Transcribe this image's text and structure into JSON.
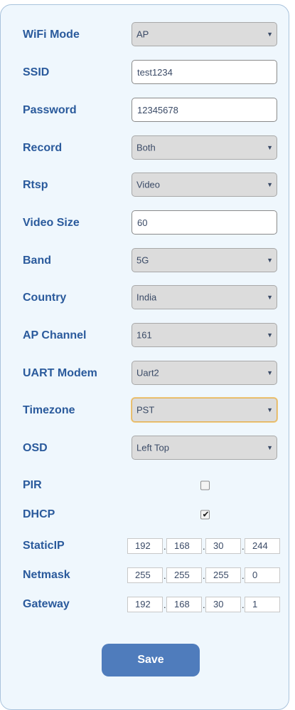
{
  "form": {
    "wifi_mode": {
      "label": "WiFi Mode",
      "value": "AP"
    },
    "ssid": {
      "label": "SSID",
      "value": "test1234"
    },
    "password": {
      "label": "Password",
      "value": "12345678"
    },
    "record": {
      "label": "Record",
      "value": "Both"
    },
    "rtsp": {
      "label": "Rtsp",
      "value": "Video"
    },
    "video_size": {
      "label": "Video Size",
      "value": "60"
    },
    "band": {
      "label": "Band",
      "value": "5G"
    },
    "country": {
      "label": "Country",
      "value": "India"
    },
    "ap_channel": {
      "label": "AP Channel",
      "value": "161"
    },
    "uart_modem": {
      "label": "UART Modem",
      "value": "Uart2"
    },
    "timezone": {
      "label": "Timezone",
      "value": "PST"
    },
    "osd": {
      "label": "OSD",
      "value": "Left Top"
    },
    "pir": {
      "label": "PIR",
      "checked": false
    },
    "dhcp": {
      "label": "DHCP",
      "checked": true,
      "tick": "✔"
    },
    "static_ip": {
      "label": "StaticIP",
      "octets": [
        "192",
        "168",
        "30",
        "244"
      ]
    },
    "netmask": {
      "label": "Netmask",
      "octets": [
        "255",
        "255",
        "255",
        "0"
      ]
    },
    "gateway": {
      "label": "Gateway",
      "octets": [
        "192",
        "168",
        "30",
        "1"
      ]
    },
    "dot": "."
  },
  "icons": {
    "dropdown_arrow": "▼"
  },
  "save_label": "Save",
  "colors": {
    "label": "#2a5a9c",
    "panel_bg": "#eff7fd",
    "button": "#4f7cbc",
    "focus_border": "#e2b259"
  }
}
